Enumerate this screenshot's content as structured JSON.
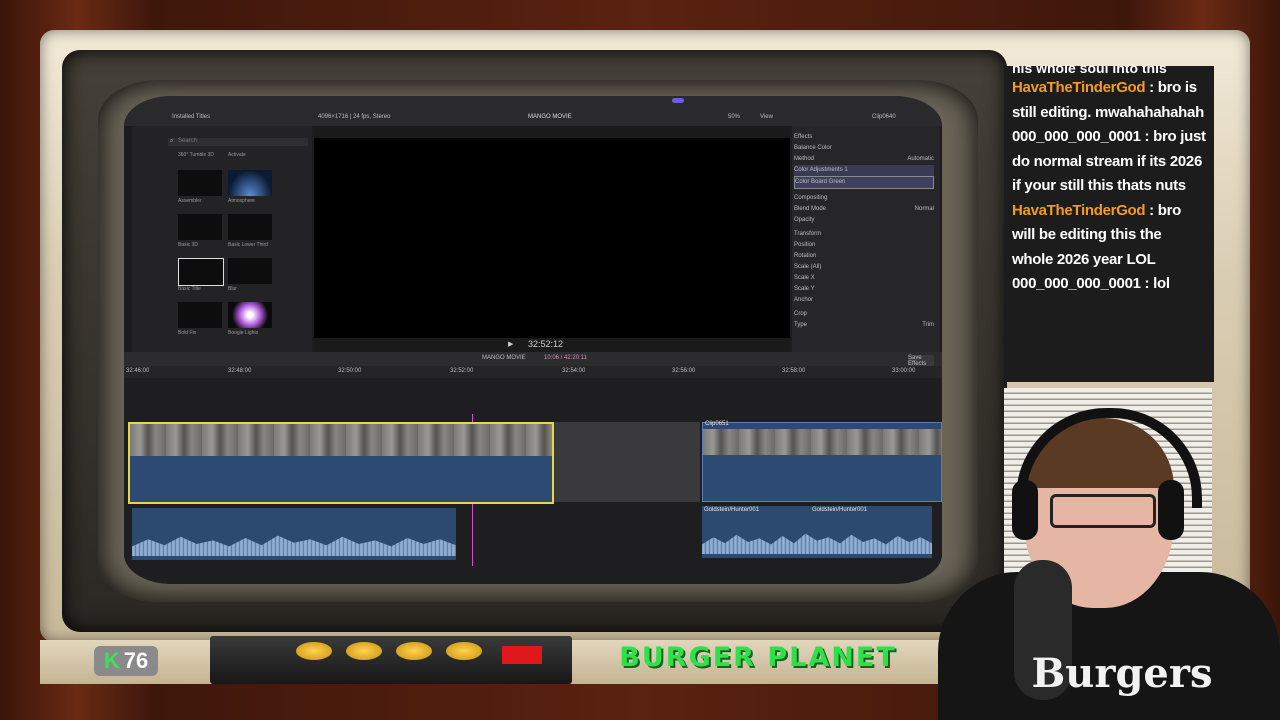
{
  "fcp": {
    "browser_header": "Installed Titles",
    "search_placeholder": "Search",
    "thumb_labels": [
      "360° Tumble 3D",
      "Activate",
      "Assembler",
      "Atmosphere",
      "Basic 3D",
      "Basic Lower Third",
      "Basic Title",
      "Blur",
      "Bold Fin",
      "Boogie Lights"
    ],
    "viewer_info": "4096×1716 | 24 fps, Stereo",
    "project_name": "MANGO MOVIE",
    "zoom": "50%",
    "view_label": "View",
    "timecode": "32:52:12",
    "timeline_project": "MANGO MOVIE",
    "timeline_duration": "10:06 / 42:20:11",
    "inspector_clip": "Clip0640",
    "inspector_items": [
      "Effects",
      "Balance Color",
      "Method",
      "Automatic",
      "Color Adjustments 1",
      "Color Board Green",
      "Compositing",
      "Blend Mode",
      "Normal",
      "Opacity",
      "Transform",
      "Position",
      "Rotation",
      "Scale (All)",
      "Scale X",
      "Scale Y",
      "Anchor",
      "Crop",
      "Type",
      "Trim"
    ],
    "save_effects": "Save Effects",
    "ruler_marks": [
      "32:46:00",
      "32:48:00",
      "32:50:00",
      "32:52:00",
      "32:54:00",
      "32:56:00",
      "32:58:00",
      "33:00:00"
    ],
    "second_clip_label": "Clip0651",
    "audio_clip_label_1": "Goldstein/Hunter001",
    "audio_clip_label_2": "Goldstein/Hunter001"
  },
  "chat": {
    "top_partial": "his whole soul into this",
    "messages": [
      {
        "user": "HavaTheTinderGod",
        "text": "bro is still editing. mwahahahahah"
      },
      {
        "user": "000_000_000_0001",
        "text": "bro just do normal stream if its 2026 if your still this thats nuts"
      },
      {
        "user": "HavaTheTinderGod",
        "text": "bro will be editing this the whole 2026 year LOL"
      },
      {
        "user": "000_000_000_0001",
        "text": "lol"
      }
    ],
    "user_color": "#f59a23"
  },
  "badge": {
    "letter": "K",
    "count": "76"
  },
  "brand": {
    "title": "BURGER PLANET",
    "color": "#2fe04a"
  },
  "webcam": {
    "shirt_text": "Burgers"
  }
}
